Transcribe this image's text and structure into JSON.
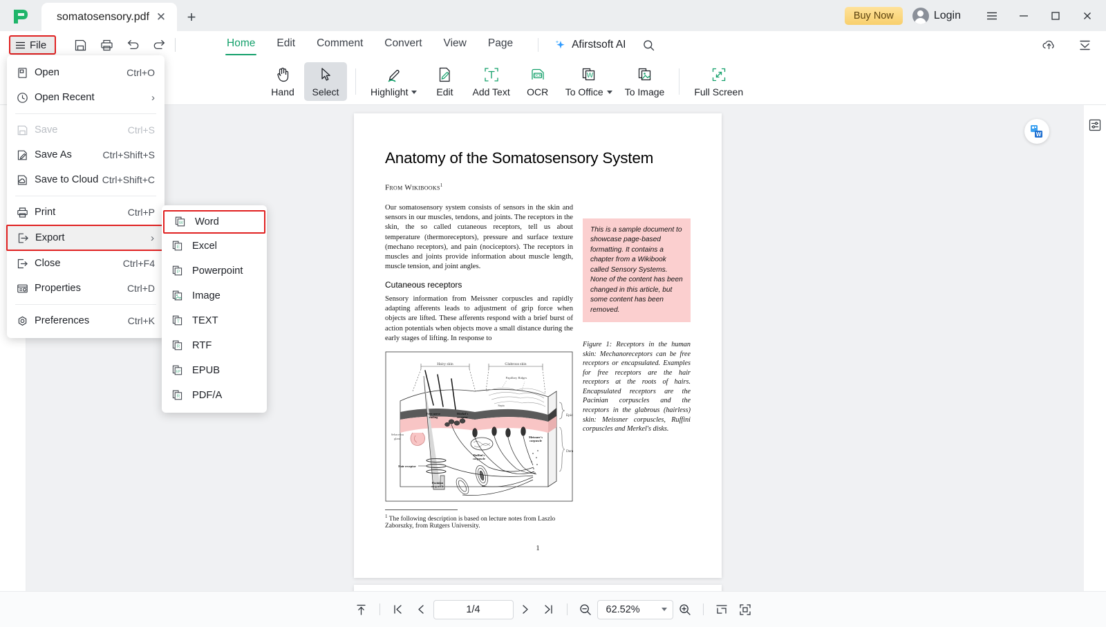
{
  "titlebar": {
    "logo_icon": "afirstsoft-leaf-logo",
    "tab_title": "somatosensory.pdf",
    "tab_close_icon": "close-icon",
    "new_tab_icon": "plus-icon",
    "buy_now_label": "Buy Now",
    "login_label": "Login",
    "menu_icon": "hamburger-menu-icon",
    "minimize_icon": "minimize-icon",
    "maximize_icon": "maximize-icon",
    "close_icon": "window-close-icon"
  },
  "ribbon": {
    "file_label": "File",
    "file_icon": "hamburger-icon",
    "quick_tools": [
      {
        "name": "save-icon",
        "label": "Save"
      },
      {
        "name": "print-icon",
        "label": "Print"
      },
      {
        "name": "undo-icon",
        "label": "Undo"
      },
      {
        "name": "redo-icon",
        "label": "Redo"
      }
    ],
    "tabs": [
      {
        "label": "Home",
        "active": true
      },
      {
        "label": "Edit",
        "active": false
      },
      {
        "label": "Comment",
        "active": false
      },
      {
        "label": "Convert",
        "active": false
      },
      {
        "label": "View",
        "active": false
      },
      {
        "label": "Page",
        "active": false
      }
    ],
    "ai_label": "Afirstsoft AI",
    "ai_icon": "sparkle-icon",
    "search_icon": "search-icon",
    "cloud_upload_icon": "cloud-upload-icon",
    "collapse_icon": "collapse-ribbon-icon"
  },
  "toolbar": {
    "tools": [
      {
        "label": "Hand",
        "icon": "hand-icon",
        "selected": false,
        "dropdown": false
      },
      {
        "label": "Select",
        "icon": "cursor-arrow-icon",
        "selected": true,
        "dropdown": false
      },
      {
        "label": "Highlight",
        "icon": "highlighter-pen-icon",
        "selected": false,
        "dropdown": true
      },
      {
        "label": "Edit",
        "icon": "edit-document-icon",
        "selected": false,
        "dropdown": false
      },
      {
        "label": "Add Text",
        "icon": "add-text-icon",
        "selected": false,
        "dropdown": false
      },
      {
        "label": "OCR",
        "icon": "ocr-icon",
        "selected": false,
        "dropdown": false
      },
      {
        "label": "To Office",
        "icon": "to-office-icon",
        "selected": false,
        "dropdown": true
      },
      {
        "label": "To Image",
        "icon": "to-image-icon",
        "selected": false,
        "dropdown": false
      },
      {
        "label": "Full Screen",
        "icon": "full-screen-icon",
        "selected": false,
        "dropdown": false
      }
    ]
  },
  "file_menu": {
    "items": [
      {
        "label": "Open",
        "shortcut": "Ctrl+O",
        "icon": "open-file-icon",
        "state": "normal",
        "submenu": false
      },
      {
        "label": "Open Recent",
        "shortcut": "",
        "icon": "clock-icon",
        "state": "normal",
        "submenu": true
      },
      {
        "separator_after": true
      },
      {
        "label": "Save",
        "shortcut": "Ctrl+S",
        "icon": "save-disk-icon",
        "state": "disabled",
        "submenu": false
      },
      {
        "label": "Save As",
        "shortcut": "Ctrl+Shift+S",
        "icon": "save-as-icon",
        "state": "normal",
        "submenu": false
      },
      {
        "label": "Save to Cloud",
        "shortcut": "Ctrl+Shift+C",
        "icon": "save-cloud-icon",
        "state": "normal",
        "submenu": false
      },
      {
        "separator_after": true
      },
      {
        "label": "Print",
        "shortcut": "Ctrl+P",
        "icon": "printer-icon",
        "state": "normal",
        "submenu": false
      },
      {
        "label": "Export",
        "shortcut": "",
        "icon": "export-icon",
        "state": "highlighted",
        "submenu": true
      },
      {
        "label": "Close",
        "shortcut": "Ctrl+F4",
        "icon": "close-door-icon",
        "state": "normal",
        "submenu": false
      },
      {
        "label": "Properties",
        "shortcut": "Ctrl+D",
        "icon": "properties-icon",
        "state": "normal",
        "submenu": false
      },
      {
        "separator_after": true
      },
      {
        "label": "Preferences",
        "shortcut": "Ctrl+K",
        "icon": "preferences-gear-icon",
        "state": "normal",
        "submenu": false
      }
    ]
  },
  "export_submenu": {
    "items": [
      {
        "label": "Word",
        "icon": "word-file-icon",
        "glyph": "W",
        "highlighted": true
      },
      {
        "label": "Excel",
        "icon": "excel-file-icon",
        "glyph": "E",
        "highlighted": false
      },
      {
        "label": "Powerpoint",
        "icon": "powerpoint-file-icon",
        "glyph": "P",
        "highlighted": false
      },
      {
        "label": "Image",
        "icon": "image-file-icon",
        "glyph": "",
        "highlighted": false
      },
      {
        "label": "TEXT",
        "icon": "text-file-icon",
        "glyph": "T",
        "highlighted": false
      },
      {
        "label": "RTF",
        "icon": "rtf-file-icon",
        "glyph": "R",
        "highlighted": false
      },
      {
        "label": "EPUB",
        "icon": "epub-file-icon",
        "glyph": "EP",
        "highlighted": false
      },
      {
        "label": "PDF/A",
        "icon": "pdfa-file-icon",
        "glyph": "R",
        "highlighted": false
      }
    ]
  },
  "document": {
    "title": "Anatomy of the Somatosensory System",
    "from_line": "From Wikibooks",
    "from_sup": "1",
    "paragraph1": "Our somatosensory system consists of sensors in the skin and sensors in our muscles, tendons, and joints. The receptors in the skin, the so called cutaneous receptors, tell us about temperature (thermoreceptors), pressure and surface texture (mechano receptors), and pain (nociceptors). The receptors in muscles and joints provide information about muscle length, muscle tension, and joint angles.",
    "section_heading": "Cutaneous receptors",
    "paragraph2": "Sensory information from Meissner corpuscles and rapidly adapting afferents leads to adjustment of grip force when objects are lifted. These afferents respond with a brief burst of action potentials when objects move a small distance during the early stages of lifting. In response to",
    "callout": "This is a sample document to showcase page-based formatting. It contains a chapter from a Wikibook called Sensory Systems. None of the content has been changed in this article, but some content has been removed.",
    "figure_caption": "Figure 1:  Receptors in the human skin: Mechanoreceptors can be free receptors or encapsulated. Examples for free receptors are the hair receptors at the roots of hairs. Encapsulated receptors are the Pacinian corpuscles and the receptors in the glabrous (hairless) skin: Meissner corpuscles, Ruffini corpuscles and Merkel's disks.",
    "footnote": "The following description is based on lecture notes from Laszlo Zaborszky, from Rutgers University.",
    "footnote_sup": "1",
    "page_number": "1",
    "figure_labels": {
      "hairy_skin": "Hairy skin",
      "glabrous_skin": "Glabrous skin",
      "papillary_ridges": "Papillary Ridges",
      "septa": "Septa",
      "epidermis": "Epidermis",
      "dermis": "Dermis",
      "free_nerve_ending": "Free nerve ending",
      "merkels_receptor": "Merkel's receptor",
      "sebaceous_gland": "Sebaceous gland",
      "hair_receptor": "Hair receptor",
      "ruffinis_corpuscle": "Ruffini's corpuscle",
      "meissners_corpuscle": "Meissner's corpuscle",
      "pacinian_corpuscle": "Pacinian corpuscle"
    }
  },
  "float_badge": {
    "icon": "word-convert-badge-icon"
  },
  "right_rail": {
    "icons": [
      {
        "name": "page-properties-panel-icon"
      }
    ]
  },
  "statusbar": {
    "scroll_top_icon": "scroll-to-top-icon",
    "first_page_icon": "first-page-icon",
    "prev_page_icon": "previous-page-icon",
    "page_value": "1/4",
    "next_page_icon": "next-page-icon",
    "last_page_icon": "last-page-icon",
    "zoom_out_icon": "zoom-out-icon",
    "zoom_value": "62.52%",
    "zoom_in_icon": "zoom-in-icon",
    "fit_width_icon": "fit-width-icon",
    "fit_page_icon": "fit-page-icon"
  },
  "colors": {
    "accent_green": "#14a06b",
    "highlight_red": "#e02020",
    "buy_now_gold": "#f8cf6c",
    "callout_pink": "#fbcfcf",
    "titlebar_gray": "#eceef0",
    "canvas_gray": "#f0f1f3"
  }
}
